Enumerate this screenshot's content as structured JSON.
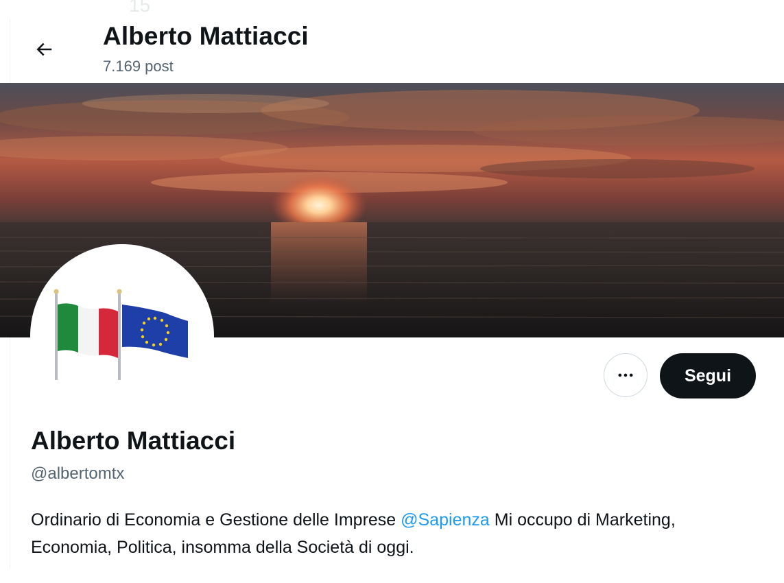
{
  "header": {
    "back_icon": "arrow-left-icon",
    "title": "Alberto Mattiacci",
    "post_count": "7.169 post",
    "ghost_text": "15"
  },
  "banner": {
    "description_icon": "sunset-over-sea-image"
  },
  "avatar": {
    "icon": "italy-eu-flags-image"
  },
  "actions": {
    "more_icon": "more-horizontal-icon",
    "follow_label": "Segui"
  },
  "profile": {
    "name": "Alberto Mattiacci",
    "handle": "@albertomtx",
    "bio_before": "Ordinario di Economia e Gestione delle Imprese ",
    "bio_mention": "@Sapienza",
    "bio_after": " Mi occupo di Marketing, Economia, Politica, insomma della Società di oggi."
  },
  "colors": {
    "text_primary": "#0f1419",
    "text_secondary": "#536471",
    "accent": "#1d9bf0",
    "button_dark": "#0f1419"
  }
}
